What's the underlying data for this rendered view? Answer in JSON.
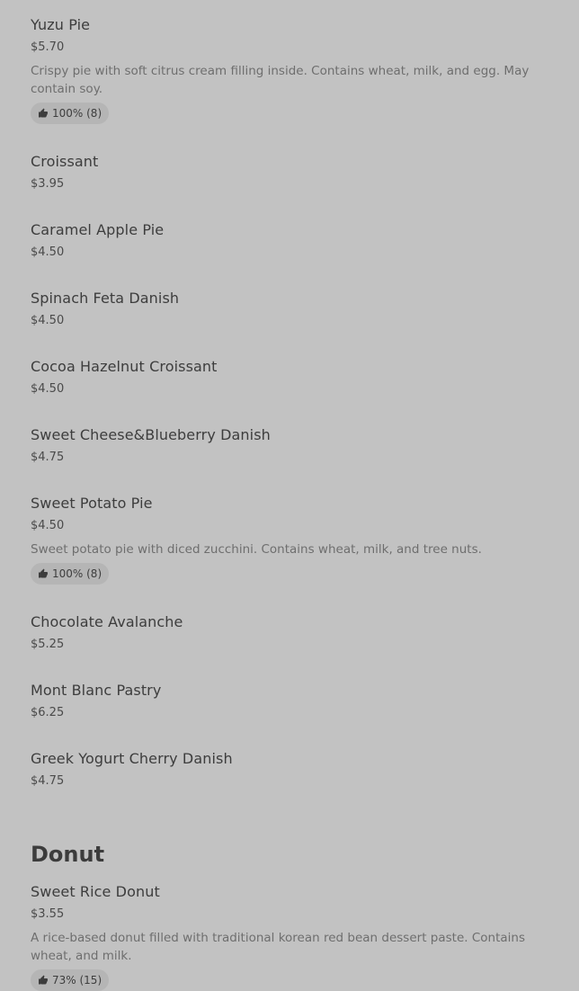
{
  "icons": {
    "rating": "thumbs-up-icon"
  },
  "colors": {
    "background": "#c2c2c2",
    "text": "#3c3c3c",
    "muted_text": "#6e6e6e",
    "rating_pill": "#b5b5b5"
  },
  "items": [
    {
      "name": "Yuzu Pie",
      "price": "$5.70",
      "description": "Crispy pie with soft citrus cream filling inside. Contains wheat, milk, and egg. May contain soy.",
      "rating": "100% (8)"
    },
    {
      "name": "Croissant",
      "price": "$3.95"
    },
    {
      "name": "Caramel Apple Pie",
      "price": "$4.50"
    },
    {
      "name": "Spinach Feta Danish",
      "price": "$4.50"
    },
    {
      "name": "Cocoa Hazelnut Croissant",
      "price": "$4.50"
    },
    {
      "name": "Sweet Cheese&Blueberry Danish",
      "price": "$4.75"
    },
    {
      "name": "Sweet Potato Pie",
      "price": "$4.50",
      "description": "Sweet potato pie with diced zucchini. Contains wheat, milk, and tree nuts.",
      "rating": "100% (8)"
    },
    {
      "name": "Chocolate Avalanche",
      "price": "$5.25"
    },
    {
      "name": "Mont Blanc Pastry",
      "price": "$6.25"
    },
    {
      "name": "Greek Yogurt Cherry Danish",
      "price": "$4.75"
    }
  ],
  "donut_section": {
    "title": "Donut",
    "items": [
      {
        "name": "Sweet Rice Donut",
        "price": "$3.55",
        "description": "A rice-based donut filled with traditional korean red bean dessert paste. Contains wheat, and milk.",
        "rating": "73% (15)"
      }
    ]
  }
}
